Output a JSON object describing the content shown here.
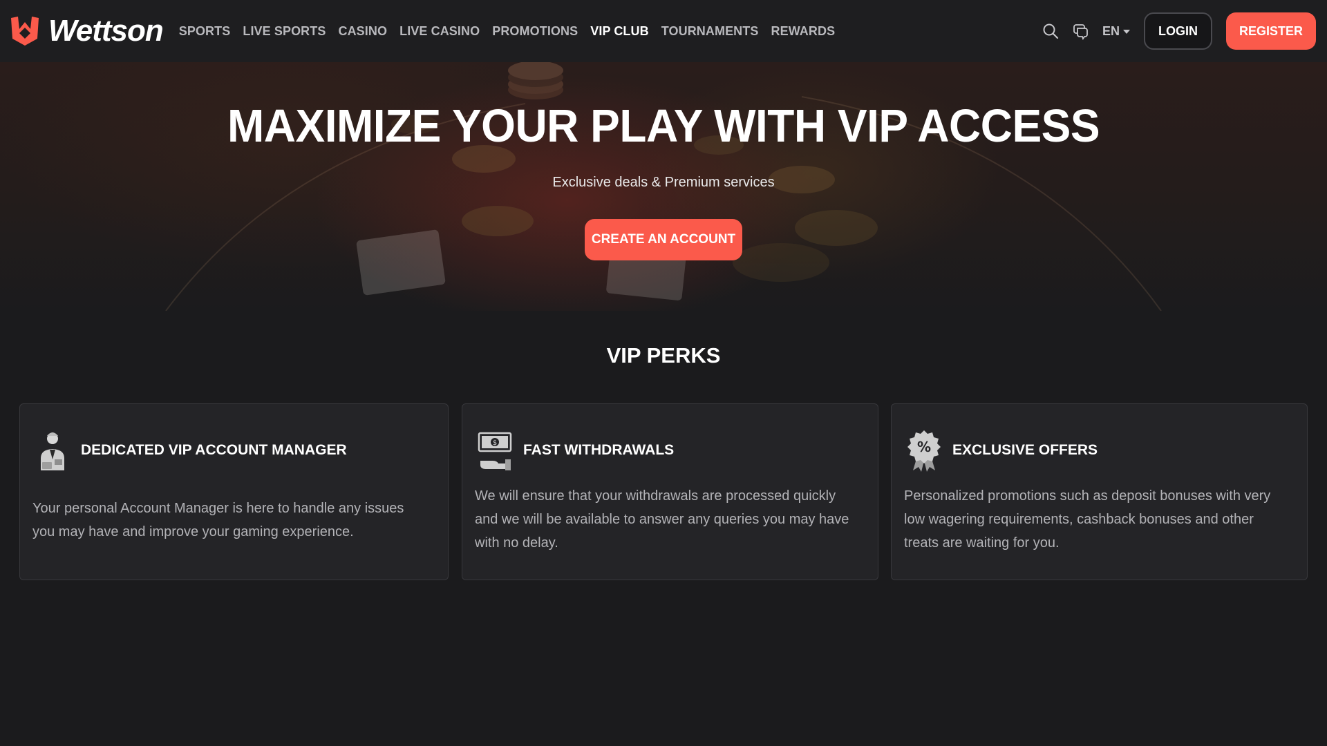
{
  "header": {
    "brand": "Wettson",
    "nav": [
      {
        "label": "SPORTS",
        "active": false
      },
      {
        "label": "LIVE SPORTS",
        "active": false
      },
      {
        "label": "CASINO",
        "active": false
      },
      {
        "label": "LIVE CASINO",
        "active": false
      },
      {
        "label": "PROMOTIONS",
        "active": false
      },
      {
        "label": "VIP CLUB",
        "active": true
      },
      {
        "label": "TOURNAMENTS",
        "active": false
      },
      {
        "label": "REWARDS",
        "active": false
      }
    ],
    "icons": [
      "search-icon",
      "chat-icon"
    ],
    "language": "EN",
    "login_label": "LOGIN",
    "register_label": "REGISTER"
  },
  "hero": {
    "title": "MAXIMIZE YOUR PLAY WITH VIP ACCESS",
    "subtitle": "Exclusive deals & Premium services",
    "cta_label": "CREATE AN ACCOUNT"
  },
  "perks": {
    "heading": "VIP PERKS",
    "cards": [
      {
        "icon": "account-manager-icon",
        "title": "DEDICATED VIP ACCOUNT MANAGER",
        "body": "Your personal Account Manager is here to handle any issues you may have and improve your gaming experience."
      },
      {
        "icon": "cash-withdrawal-icon",
        "title": "FAST WITHDRAWALS",
        "body": "We will ensure that your withdrawals are processed quickly and we will be available to answer any queries you may have with no delay."
      },
      {
        "icon": "discount-badge-icon",
        "title": "EXCLUSIVE OFFERS",
        "body": "Personalized promotions such as deposit bonuses with very low wagering requirements, cashback bonuses and other treats are waiting for you."
      }
    ]
  },
  "colors": {
    "accent": "#fb5a4b",
    "background": "#1b1b1d",
    "card": "#242427",
    "header": "#1e1e20"
  }
}
